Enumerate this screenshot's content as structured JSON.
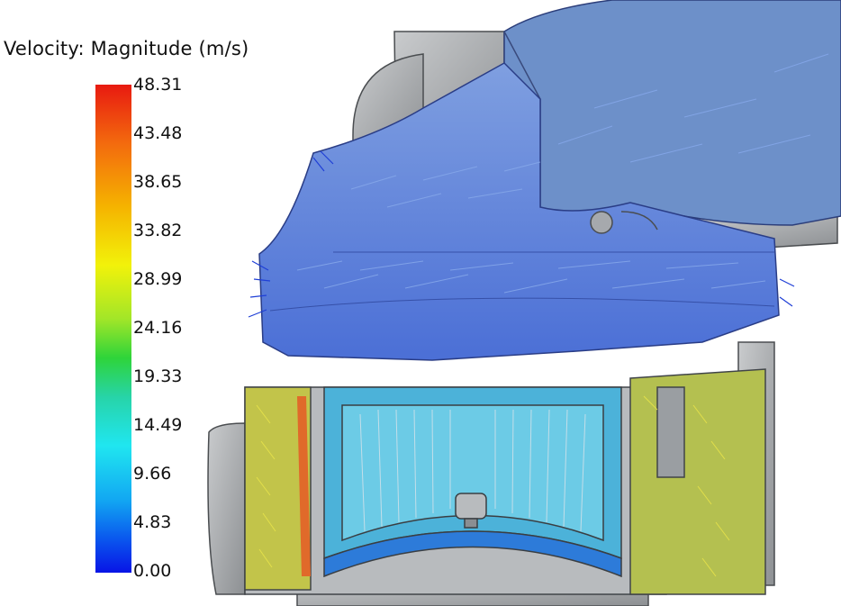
{
  "legend": {
    "title": "Velocity: Magnitude (m/s)",
    "ticks": [
      "48.31",
      "43.48",
      "38.65",
      "33.82",
      "28.99",
      "24.16",
      "19.33",
      "14.49",
      "9.66",
      "4.83",
      "0.00"
    ],
    "colors": [
      "#0814e6",
      "#0a58ee",
      "#12a8f2",
      "#20e6f0",
      "#27d4a8",
      "#2ed43a",
      "#a2e628",
      "#f2f20a",
      "#f5b300",
      "#f36a0e",
      "#e81a10"
    ]
  }
}
